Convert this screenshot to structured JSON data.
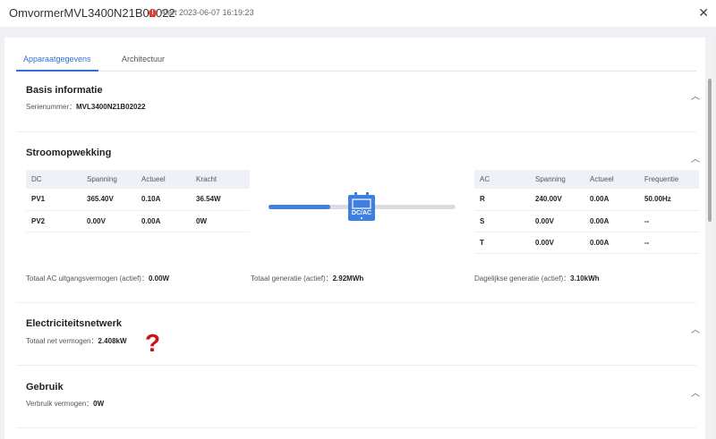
{
  "header": {
    "title": "OmvormerMVL3400N21B02022",
    "alert_label": "Alert",
    "timestamp": "2023-06-07 16:19:23",
    "close_icon": "close-icon"
  },
  "tabs": [
    {
      "label": "Apparaatgegevens",
      "active": true
    },
    {
      "label": "Architectuur",
      "active": false
    }
  ],
  "basis": {
    "title": "Basis informatie",
    "serial_label": "Serienummer：",
    "serial_value": "MVL3400N21B02022"
  },
  "stroom": {
    "title": "Stroomopwekking",
    "dc_table": {
      "headers": [
        "DC",
        "Spanning",
        "Actueel",
        "Kracht"
      ],
      "rows": [
        [
          "PV1",
          "365.40V",
          "0.10A",
          "36.54W"
        ],
        [
          "PV2",
          "0.00V",
          "0.00A",
          "0W"
        ]
      ]
    },
    "ac_table": {
      "headers": [
        "AC",
        "Spanning",
        "Actueel",
        "Frequentie"
      ],
      "rows": [
        [
          "R",
          "240.00V",
          "0.00A",
          "50.00Hz"
        ],
        [
          "S",
          "0.00V",
          "0.00A",
          "--"
        ],
        [
          "T",
          "0.00V",
          "0.00A",
          "--"
        ]
      ]
    },
    "inverter_label": "DC/AC",
    "dc_flow_fraction": 0.33,
    "totals": {
      "ac_label": "Totaal AC uitgangsvermogen (actief)：",
      "ac_value": "0.00W",
      "gen_label": "Totaal generatie (actief)：",
      "gen_value": "2.92MWh",
      "day_label": "Dagelijkse generatie (actief)：",
      "day_value": "3.10kWh"
    }
  },
  "netwerk": {
    "title": "Electriciteitsnetwerk",
    "label": "Totaal net vermogen：",
    "value": "2.408kW",
    "annotation": "?"
  },
  "gebruik": {
    "title": "Gebruik",
    "label": "Verbruik vermogen：",
    "value": "0W"
  },
  "colors": {
    "accent": "#2f6fd6",
    "alert": "#e0423a",
    "annotation": "#d0111a"
  }
}
